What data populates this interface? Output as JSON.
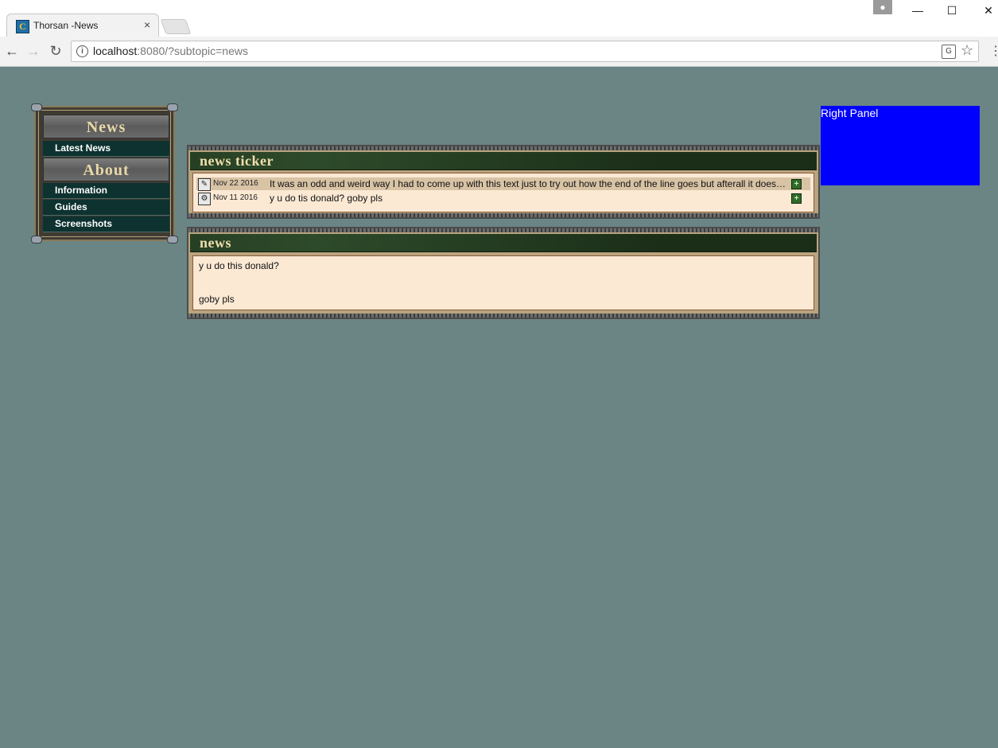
{
  "browser": {
    "tab_title": "Thorsan -News",
    "favicon_letter": "C",
    "tab_close": "×",
    "url_host": "localhost",
    "url_rest": ":8080/?subtopic=news",
    "icons": [
      "back-arrow-icon",
      "forward-arrow-icon",
      "reload-icon",
      "info-icon",
      "translate-icon",
      "star-icon",
      "menu-icon"
    ],
    "window_controls": [
      "minimize",
      "maximize",
      "close"
    ]
  },
  "menu": {
    "sections": [
      {
        "title": "News",
        "items": [
          "Latest News"
        ]
      },
      {
        "title": "About",
        "items": [
          "Information",
          "Guides",
          "Screenshots"
        ]
      }
    ]
  },
  "ticker": {
    "title": "news ticker",
    "entries": [
      {
        "date": "Nov 22 2016",
        "text": "It was an odd and weird way I had to come up with this text just to try out how the end of the line goes but afterall it does the job"
      },
      {
        "date": "Nov 11 2016",
        "text": "y u do tis donald? goby pls"
      }
    ]
  },
  "news": {
    "title": "news",
    "lines": [
      "y u do this donald?",
      "goby pls"
    ]
  },
  "right_panel": {
    "label": "Right Panel",
    "color": "#0000ff"
  }
}
